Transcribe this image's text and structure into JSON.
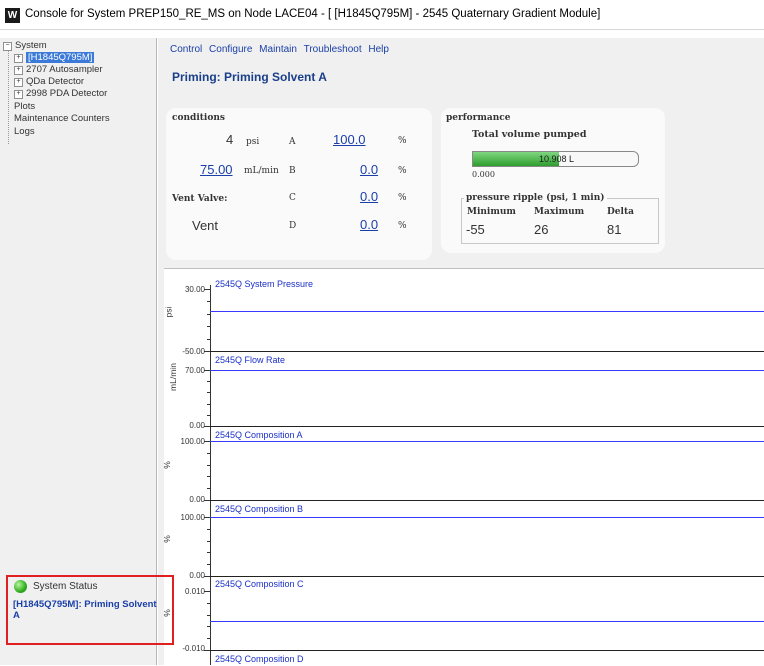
{
  "window": {
    "title": "Console for System PREP150_RE_MS on Node LACE04 - [ [H1845Q795M] - 2545 Quaternary Gradient Module]",
    "icon_glyph": "W"
  },
  "tree": {
    "system": "System",
    "items": [
      "[H1845Q795M]",
      "2707 Autosampler",
      "QDa Detector",
      "2998 PDA Detector"
    ],
    "plots": "Plots",
    "maintenance": "Maintenance Counters",
    "logs": "Logs"
  },
  "status": {
    "title": "System Status",
    "message": "[H1845Q795M]: Priming Solvent A"
  },
  "menu": [
    "Control",
    "Configure",
    "Maintain",
    "Troubleshoot",
    "Help"
  ],
  "page_title": "Priming: Priming Solvent A",
  "conditions": {
    "label": "conditions",
    "pressure_value": "4",
    "pressure_unit": "psi",
    "flow_value": "75.00",
    "flow_unit": "mL/min",
    "vent_label": "Vent Valve:",
    "vent_value": "Vent",
    "channels": [
      {
        "name": "A",
        "value": "100.0",
        "unit": "%"
      },
      {
        "name": "B",
        "value": "0.0",
        "unit": "%"
      },
      {
        "name": "C",
        "value": "0.0",
        "unit": "%"
      },
      {
        "name": "D",
        "value": "0.0",
        "unit": "%"
      }
    ]
  },
  "performance": {
    "label": "performance",
    "total_label": "Total volume pumped",
    "total_value": "10.908 L",
    "total_min": "0.000",
    "bar_fill_fraction": 0.52,
    "ripple_label": "pressure ripple (psi, 1 min)",
    "headers": [
      "Minimum",
      "Maximum",
      "Delta"
    ],
    "values": [
      "-55",
      "26",
      "81"
    ]
  },
  "graphs": [
    {
      "title": "2545Q System Pressure",
      "unit": "psi",
      "top": "30.00",
      "bottom": "-50.00"
    },
    {
      "title": "2545Q Flow Rate",
      "unit": "mL/min",
      "top": "70.00",
      "bottom": "0.00"
    },
    {
      "title": "2545Q Composition A",
      "unit": "%",
      "top": "100.00",
      "bottom": "0.00"
    },
    {
      "title": "2545Q Composition B",
      "unit": "%",
      "top": "100.00",
      "bottom": "0.00"
    },
    {
      "title": "2545Q Composition C",
      "unit": "%",
      "top": "0.010",
      "bottom": "-0.010"
    },
    {
      "title": "2545Q Composition D",
      "unit": "",
      "top": "",
      "bottom": ""
    }
  ],
  "colors": {
    "link": "#1a3fa8",
    "trace": "#3a3aff",
    "progress": "#2e9e2e",
    "status_ok": "#2fae1e",
    "highlight": "#e02020"
  }
}
